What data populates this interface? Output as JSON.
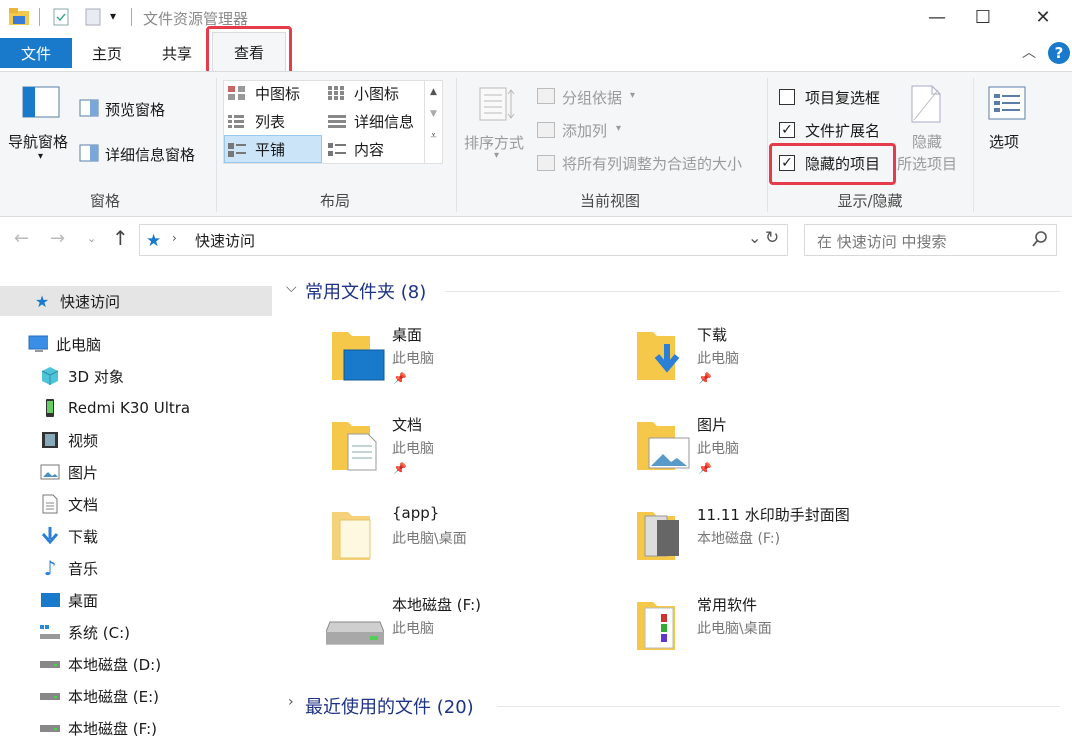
{
  "window": {
    "title": "文件资源管理器",
    "controls": {
      "minimize": "—",
      "maximize": "☐",
      "close": "✕"
    }
  },
  "ribbon_tabs": [
    {
      "label": "文件"
    },
    {
      "label": "主页"
    },
    {
      "label": "共享"
    },
    {
      "label": "查看"
    }
  ],
  "ribbon": {
    "panes": {
      "nav_pane": "导航窗格",
      "preview_pane": "预览窗格",
      "details_pane": "详细信息窗格",
      "group_label": "窗格"
    },
    "layout": {
      "options": [
        "中图标",
        "小图标",
        "列表",
        "详细信息",
        "平铺",
        "内容"
      ],
      "selected": "平铺",
      "group_label": "布局"
    },
    "current_view": {
      "sort": "排序方式",
      "group_by": "分组依据",
      "add_column": "添加列",
      "fit_columns": "将所有列调整为合适的大小",
      "group_label": "当前视图"
    },
    "show_hide": {
      "item_checkboxes": {
        "label": "项目复选框",
        "checked": false
      },
      "file_extensions": {
        "label": "文件扩展名",
        "checked": true
      },
      "hidden_items": {
        "label": "隐藏的项目",
        "checked": true
      },
      "hide_selected_1": "隐藏",
      "hide_selected_2": "所选项目",
      "group_label": "显示/隐藏"
    },
    "options": "选项"
  },
  "address": {
    "path": "快速访问",
    "search_placeholder": "在 快速访问 中搜索"
  },
  "nav": {
    "quick_access": "快速访问",
    "this_pc": "此电脑",
    "items": [
      "3D 对象",
      "Redmi K30 Ultra",
      "视频",
      "图片",
      "文档",
      "下载",
      "音乐",
      "桌面",
      "系统 (C:)",
      "本地磁盘 (D:)",
      "本地磁盘 (E:)",
      "本地磁盘 (F:)"
    ]
  },
  "content": {
    "frequent_header": "常用文件夹 (8)",
    "recent_header": "最近使用的文件 (20)",
    "tiles": [
      {
        "name": "桌面",
        "sub": "此电脑",
        "pinned": true
      },
      {
        "name": "下载",
        "sub": "此电脑",
        "pinned": true
      },
      {
        "name": "文档",
        "sub": "此电脑",
        "pinned": true
      },
      {
        "name": "图片",
        "sub": "此电脑",
        "pinned": true
      },
      {
        "name": "{app}",
        "sub": "此电脑\\桌面",
        "pinned": false
      },
      {
        "name": "11.11 水印助手封面图",
        "sub": "本地磁盘 (F:)",
        "pinned": false
      },
      {
        "name": "本地磁盘 (F:)",
        "sub": "此电脑",
        "pinned": false
      },
      {
        "name": "常用软件",
        "sub": "此电脑\\桌面",
        "pinned": false
      }
    ]
  },
  "colors": {
    "accent": "#1979ca",
    "highlight": "#e63b4a",
    "header_text": "#1e3287",
    "selected_nav": "#e5e5e5"
  }
}
